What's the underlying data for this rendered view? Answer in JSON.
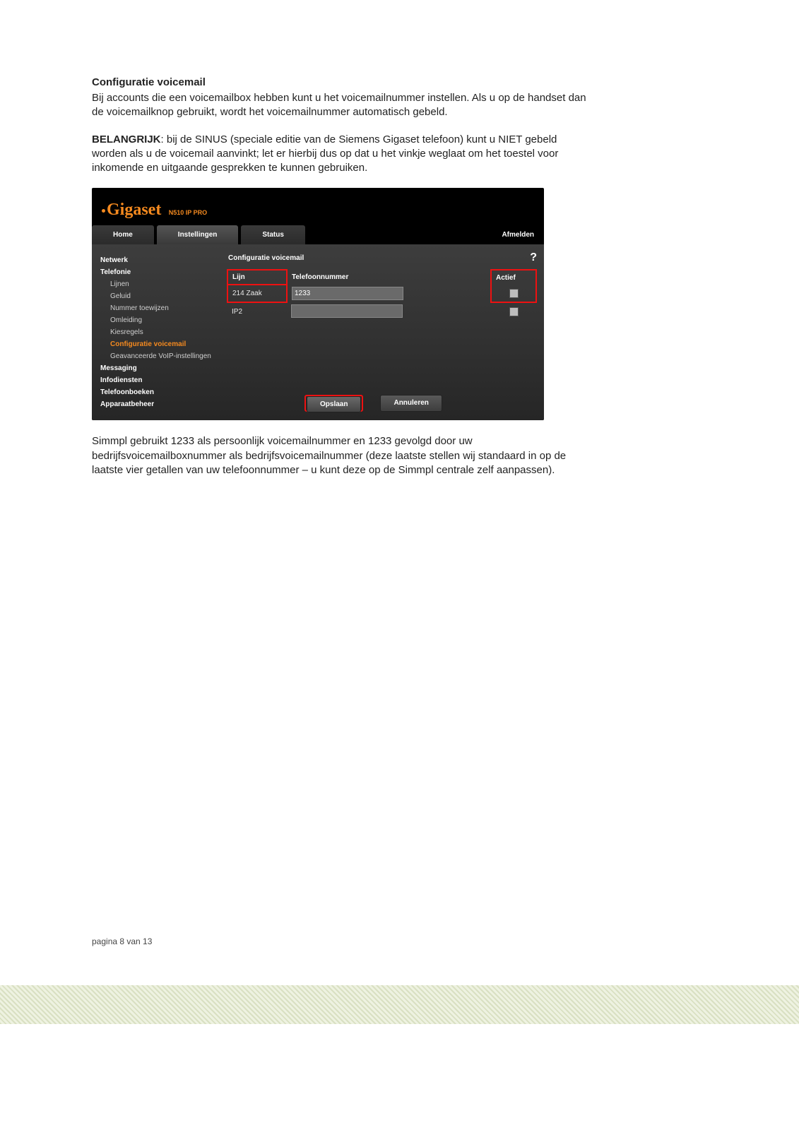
{
  "doc": {
    "title": "Configuratie voicemail",
    "p1": "Bij accounts die een voicemailbox hebben kunt u het voicemailnummer instellen. Als u op de handset dan de voicemailknop gebruikt, wordt het voicemailnummer automatisch gebeld.",
    "p2_bold": "BELANGRIJK",
    "p2_rest": ": bij de SINUS (speciale editie van de Siemens Gigaset telefoon) kunt u NIET gebeld worden als u de voicemail aanvinkt; let er hierbij dus op dat u het vinkje weglaat om het toestel voor inkomende en uitgaande gesprekken te kunnen gebruiken.",
    "p3": "Simmpl gebruikt 1233 als persoonlijk voicemailnummer en 1233 gevolgd door uw bedrijfsvoicemailboxnummer als bedrijfsvoicemailnummer (deze laatste stellen wij standaard in op de laatste vier getallen van uw telefoonnummer – u kunt deze op de Simmpl centrale zelf aanpassen).",
    "page_no": "pagina 8 van 13"
  },
  "ui": {
    "brand": "Gigaset",
    "model": "N510 IP PRO",
    "tabs": {
      "home": "Home",
      "settings": "Instellingen",
      "status": "Status"
    },
    "logout": "Afmelden",
    "help_glyph": "?",
    "sidebar": {
      "netwerk": "Netwerk",
      "telefonie": "Telefonie",
      "subs": {
        "lijnen": "Lijnen",
        "geluid": "Geluid",
        "nummer": "Nummer toewijzen",
        "omleiding": "Omleiding",
        "kiesregels": "Kiesregels",
        "conf_vm": "Configuratie voicemail",
        "adv": "Geavanceerde VoIP-instellingen"
      },
      "messaging": "Messaging",
      "infod": "Infodiensten",
      "telbk": "Telefoonboeken",
      "apparaat": "Apparaatbeheer"
    },
    "main": {
      "title": "Configuratie voicemail",
      "cols": {
        "lijn": "Lijn",
        "tel": "Telefoonnummer",
        "actief": "Actief"
      },
      "rows": [
        {
          "lijn": "214 Zaak",
          "tel": "1233"
        },
        {
          "lijn": "IP2",
          "tel": ""
        }
      ],
      "save": "Opslaan",
      "cancel": "Annuleren"
    }
  }
}
